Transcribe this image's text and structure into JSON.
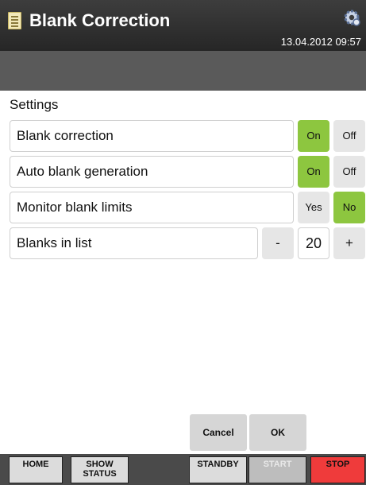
{
  "header": {
    "title": "Blank Correction",
    "datetime": "13.04.2012 09:57",
    "icons": [
      "document-icon",
      "gear-icon"
    ]
  },
  "settings": {
    "section_title": "Settings",
    "blank_correction": {
      "label": "Blank correction",
      "on": "On",
      "off": "Off",
      "selected": "On"
    },
    "auto_blank_generation": {
      "label": "Auto blank generation",
      "on": "On",
      "off": "Off",
      "selected": "On"
    },
    "monitor_blank_limits": {
      "label": "Monitor blank limits",
      "yes": "Yes",
      "no": "No",
      "selected": "No"
    },
    "blanks_in_list": {
      "label": "Blanks in list",
      "minus": "-",
      "value": "20",
      "plus": "+"
    }
  },
  "dialog": {
    "cancel": "Cancel",
    "ok": "OK"
  },
  "nav": {
    "home": "HOME",
    "show_status": "SHOW\nSTATUS",
    "standby": "STANDBY",
    "start": "START",
    "stop": "STOP"
  },
  "colors": {
    "active_green": "#8dc63f",
    "header_dark": "#2e2e2e",
    "toolbar_gray": "#5a5a5a",
    "stop_red": "#ef3b3b"
  }
}
